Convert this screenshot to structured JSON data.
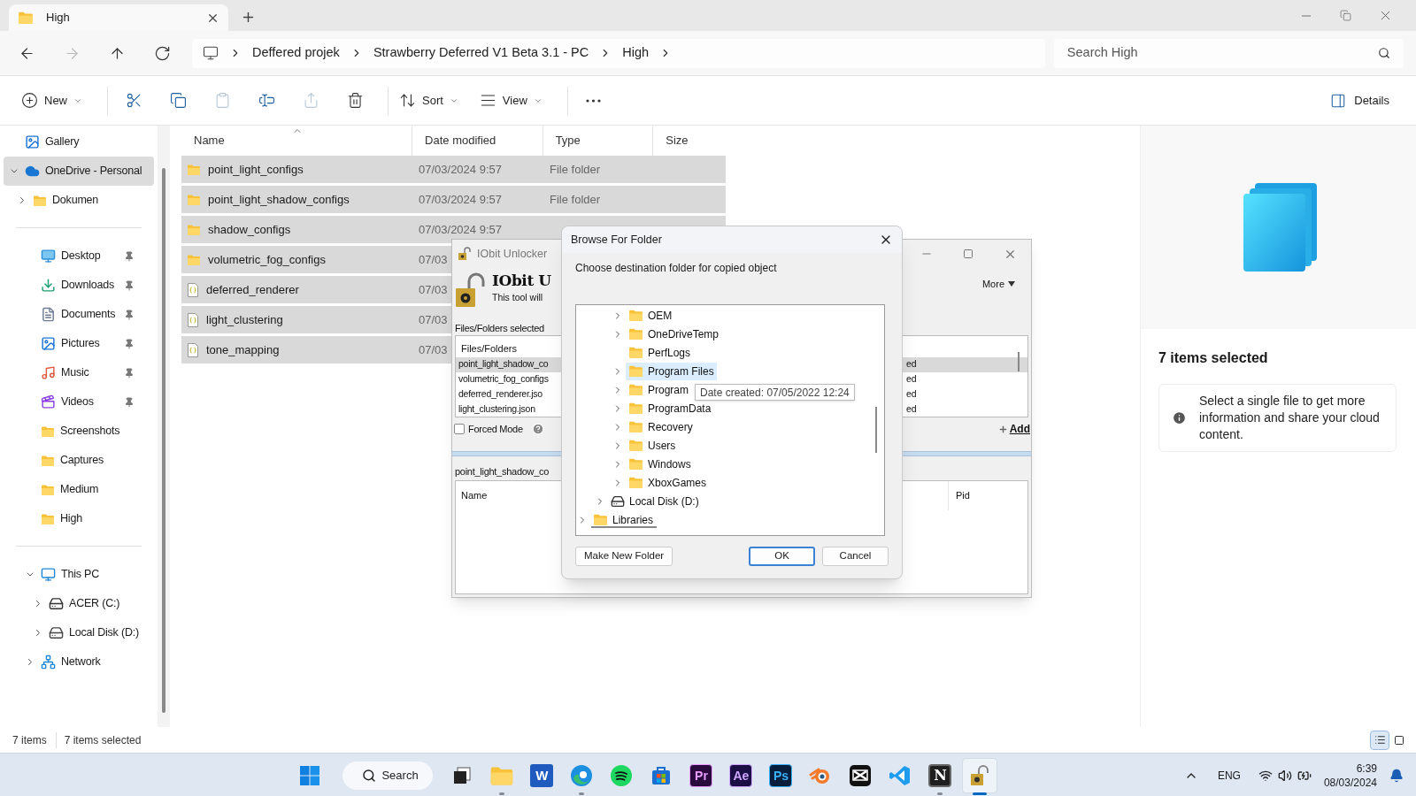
{
  "tab": {
    "title": "High"
  },
  "nav": [
    {
      "kind": "back",
      "disabled": false
    },
    {
      "kind": "forward",
      "disabled": true
    },
    {
      "kind": "up",
      "disabled": false
    },
    {
      "kind": "refresh",
      "disabled": false
    }
  ],
  "breadcrumb": [
    "Deffered projek",
    "Strawberry Deferred V1 Beta 3.1 - PC",
    "High"
  ],
  "search": {
    "placeholder": "Search High"
  },
  "toolbar": [
    {
      "kind": "new",
      "label": "New",
      "disabled": false
    },
    {
      "kind": "cut",
      "disabled": false
    },
    {
      "kind": "copy",
      "disabled": false
    },
    {
      "kind": "paste",
      "disabled": true
    },
    {
      "kind": "rename",
      "disabled": false
    },
    {
      "kind": "share",
      "disabled": true
    },
    {
      "kind": "delete",
      "disabled": false
    },
    {
      "kind": "sort",
      "label": "Sort",
      "disabled": false
    },
    {
      "kind": "view",
      "label": "View",
      "disabled": false
    },
    {
      "kind": "more",
      "disabled": false
    }
  ],
  "details_button": {
    "label": "Details"
  },
  "sidebar": {
    "groups": [
      {
        "items": [
          {
            "label": "Gallery",
            "kind": "gallery",
            "selected": false
          },
          {
            "label": "OneDrive - Personal",
            "kind": "onedrive",
            "selected": true,
            "expanded": true,
            "children": [
              {
                "label": "Dokumen",
                "kind": "folder",
                "selected": false,
                "expanded": false
              }
            ]
          }
        ]
      },
      {
        "items": [
          {
            "label": "Desktop",
            "kind": "desktop",
            "selected": false,
            "pinned": true
          },
          {
            "label": "Downloads",
            "kind": "downloads",
            "selected": false,
            "pinned": true
          },
          {
            "label": "Documents",
            "kind": "documents",
            "selected": false,
            "pinned": true
          },
          {
            "label": "Pictures",
            "kind": "pictures",
            "selected": false,
            "pinned": true
          },
          {
            "label": "Music",
            "kind": "music",
            "selected": false,
            "pinned": true
          },
          {
            "label": "Videos",
            "kind": "videos",
            "selected": false,
            "pinned": true
          },
          {
            "label": "Screenshots",
            "kind": "folder",
            "selected": false,
            "pinned": false
          },
          {
            "label": "Captures",
            "kind": "folder",
            "selected": false,
            "pinned": false
          },
          {
            "label": "Medium",
            "kind": "folder",
            "selected": false,
            "pinned": false
          },
          {
            "label": "High",
            "kind": "folder",
            "selected": false,
            "pinned": false
          }
        ]
      },
      {
        "items": [
          {
            "label": "This PC",
            "kind": "pc",
            "selected": false,
            "expanded": true,
            "children": [
              {
                "label": "ACER (C:)",
                "kind": "system-drive",
                "selected": false,
                "expanded": false
              },
              {
                "label": "Local Disk (D:)",
                "kind": "drive",
                "selected": false,
                "expanded": false
              }
            ]
          },
          {
            "label": "Network",
            "kind": "network",
            "selected": false,
            "expanded": false
          }
        ]
      }
    ]
  },
  "file_list": {
    "columns": [
      "Name",
      "Date modified",
      "Type",
      "Size"
    ],
    "rows": [
      {
        "name": "point_light_configs",
        "kind": "folder",
        "date": "07/03/2024 9:57",
        "type": "File folder",
        "selected": true
      },
      {
        "name": "point_light_shadow_configs",
        "kind": "folder",
        "date": "07/03/2024 9:57",
        "type": "File folder",
        "selected": true
      },
      {
        "name": "shadow_configs",
        "kind": "folder",
        "date": "07/03/2024 9:57",
        "selected": true
      },
      {
        "name": "volumetric_fog_configs",
        "kind": "folder",
        "date": "07/03",
        "selected": true
      },
      {
        "name": "deferred_renderer",
        "kind": "json",
        "date": "07/03",
        "selected": true
      },
      {
        "name": "light_clustering",
        "kind": "json",
        "date": "07/03",
        "selected": true
      },
      {
        "name": "tone_mapping",
        "kind": "json",
        "date": "07/03",
        "selected": true
      }
    ]
  },
  "details_pane": {
    "title": "7 items selected",
    "info": "Select a single file to get more information and share your cloud content."
  },
  "status_bar": {
    "count": "7 items",
    "selection": "7 items selected",
    "views": [
      {
        "kind": "details",
        "selected": true
      },
      {
        "kind": "tiles",
        "selected": false
      }
    ]
  },
  "iobit": {
    "title": "IObit Unlocker",
    "heading": "IObit U",
    "subtitle": "This tool will",
    "more": "More",
    "list_label": "Files/Folders selected",
    "list_header": "Files/Folders",
    "list_rows": [
      {
        "name": "point_light_shadow_co",
        "status": "ed",
        "selected": true
      },
      {
        "name": "volumetric_fog_configs",
        "status": "ed",
        "selected": false
      },
      {
        "name": "deferred_renderer.jso",
        "status": "ed",
        "selected": false
      },
      {
        "name": "light_clustering.json",
        "status": "ed",
        "selected": false
      }
    ],
    "forced_mode": {
      "label": "Forced Mode",
      "checked": false
    },
    "add": "Add",
    "target": "point_light_shadow_co",
    "process_columns": [
      "Name",
      "Pid"
    ]
  },
  "browse": {
    "title": "Browse For Folder",
    "prompt": "Choose destination folder for copied object",
    "tree": [
      {
        "children": [
          {
            "children": [
              {
                "label": "OEM",
                "kind": "folder",
                "expandable": true,
                "selected": false
              },
              {
                "label": "OneDriveTemp",
                "kind": "folder",
                "expandable": true,
                "selected": false
              },
              {
                "label": "PerfLogs",
                "kind": "folder",
                "expandable": false,
                "selected": false
              },
              {
                "label": "Program Files",
                "kind": "folder",
                "expandable": true,
                "selected": true
              },
              {
                "label": "Program",
                "kind": "folder",
                "expandable": true,
                "selected": false
              },
              {
                "label": "ProgramData",
                "kind": "folder",
                "expandable": true,
                "selected": false
              },
              {
                "label": "Recovery",
                "kind": "folder",
                "expandable": true,
                "selected": false
              },
              {
                "label": "Users",
                "kind": "folder",
                "expandable": true,
                "selected": false
              },
              {
                "label": "Windows",
                "kind": "folder",
                "expandable": true,
                "selected": false
              },
              {
                "label": "XboxGames",
                "kind": "folder",
                "expandable": true,
                "selected": false
              }
            ]
          },
          {
            "label": "Local Disk (D:)",
            "kind": "drive",
            "expandable": true,
            "selected": false
          }
        ]
      },
      {
        "label": "Libraries",
        "kind": "folder",
        "expandable": true,
        "selected": false
      }
    ],
    "tooltip": "Date created: 07/05/2022 12:24",
    "buttons": [
      {
        "label": "Make New Folder",
        "default": false
      },
      {
        "label": "OK",
        "default": true
      },
      {
        "label": "Cancel",
        "default": false
      }
    ]
  },
  "taskbar": {
    "search": "Search",
    "apps": [
      {
        "kind": "taskview",
        "running": false,
        "selected": false
      },
      {
        "kind": "explorer",
        "running": true,
        "selected": false
      },
      {
        "kind": "word",
        "label": "W",
        "running": false,
        "selected": false
      },
      {
        "kind": "edge",
        "running": true,
        "selected": false
      },
      {
        "kind": "spotify",
        "running": false,
        "selected": false
      },
      {
        "kind": "store",
        "running": false,
        "selected": false
      },
      {
        "kind": "premiere",
        "label": "Pr",
        "running": false,
        "selected": false
      },
      {
        "kind": "aftereffects",
        "label": "Ae",
        "running": false,
        "selected": false
      },
      {
        "kind": "photoshop",
        "label": "Ps",
        "running": false,
        "selected": false
      },
      {
        "kind": "blender",
        "running": false,
        "selected": false
      },
      {
        "kind": "capcut",
        "running": false,
        "selected": false
      },
      {
        "kind": "vscode",
        "running": false,
        "selected": false
      },
      {
        "kind": "notion",
        "label": "N",
        "running": true,
        "selected": false
      },
      {
        "kind": "iobit",
        "running": true,
        "selected": true
      }
    ]
  },
  "tray": {
    "language": "ENG",
    "time": "6:39",
    "date": "08/03/2024"
  }
}
